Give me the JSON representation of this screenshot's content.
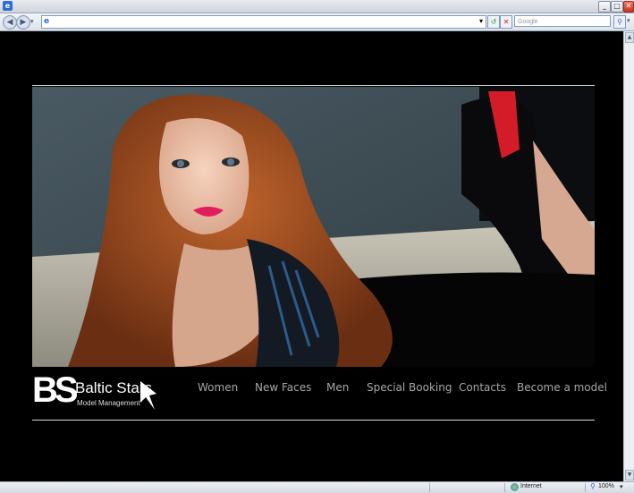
{
  "browser": {
    "address_value": "",
    "search_placeholder": "Google",
    "status_zone": "Internet",
    "zoom": "100%"
  },
  "brand": {
    "monogram": "BS",
    "name": "Baltic Stars",
    "tagline": "Model Management"
  },
  "menu": {
    "items": [
      {
        "label": "Women"
      },
      {
        "label": "New Faces"
      },
      {
        "label": "Men"
      },
      {
        "label": "Special Booking"
      },
      {
        "label": "Contacts"
      },
      {
        "label": "Become a model"
      }
    ]
  },
  "hero": {
    "image": "model-photo"
  },
  "icons": {
    "app": "ie-logo-icon",
    "back": "back-arrow-icon",
    "forward": "forward-arrow-icon",
    "refresh": "refresh-icon",
    "stop": "stop-icon",
    "search": "search-icon",
    "globe": "globe-icon",
    "zoom": "zoom-icon"
  },
  "colors": {
    "background": "#000000",
    "menu_text": "#a6a6a6",
    "rule": "#d9d9d9",
    "accent_red": "#d31c27"
  }
}
